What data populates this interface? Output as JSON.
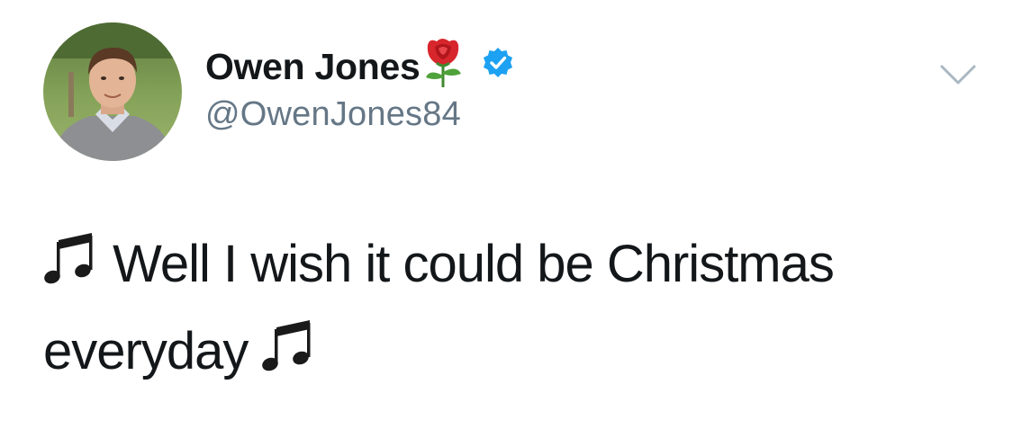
{
  "author": {
    "display_name": "Owen Jones",
    "handle": "@OwenJones84",
    "verified": true,
    "badge_emoji": "rose"
  },
  "tweet": {
    "line1": "Well I wish it could be Christmas",
    "line2": "everyday",
    "leading_emoji": "musical-notes",
    "trailing_emoji": "musical-notes"
  },
  "menu": {
    "icon": "chevron-down-icon"
  },
  "colors": {
    "text": "#14171a",
    "secondary": "#657786",
    "verified_blue": "#1da1f2",
    "caret": "#aab8c2"
  }
}
